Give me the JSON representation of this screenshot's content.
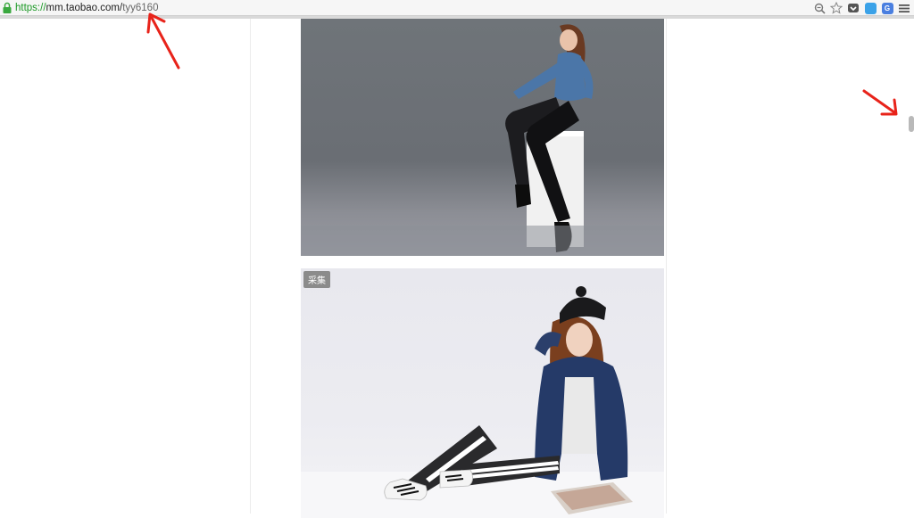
{
  "browser": {
    "url": {
      "scheme": "https://",
      "host": "mm.taobao.com/",
      "path": "tyy6160"
    },
    "icons": [
      "lock-icon",
      "zoom-icon",
      "bookmark-star-icon",
      "pocket-icon",
      "extension-icon",
      "translate-icon",
      "menu-icon"
    ]
  },
  "content": {
    "photos": [
      {
        "subject": "product-photo"
      },
      {
        "subject": "product-photo",
        "tag": "采集"
      }
    ]
  },
  "colors": {
    "url_scheme": "#1e9a28",
    "annotation_arrow": "#e8231a",
    "tag_bg": "#8b8b8b"
  }
}
